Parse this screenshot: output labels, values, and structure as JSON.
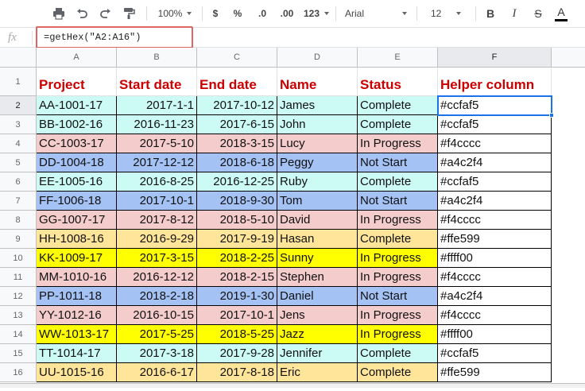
{
  "toolbar": {
    "zoom": "100%",
    "currency": "$",
    "percent": "%",
    "decrease_decimal": ".0",
    "increase_decimal": ".00",
    "number_format": "123",
    "font": "Arial",
    "font_size": "12",
    "bold": "B",
    "italic": "I",
    "strikethrough": "S",
    "text_color": "A"
  },
  "formula_bar": {
    "fx_label": "fx",
    "formula": "=getHex(\"A2:A16\")"
  },
  "columns": [
    "A",
    "B",
    "C",
    "D",
    "E",
    "F"
  ],
  "header": {
    "row_number": "1",
    "labels": [
      "Project",
      "Start date",
      "End date",
      "Name",
      "Status",
      "Helper column"
    ]
  },
  "rows": [
    {
      "n": "2",
      "project": "AA-1001-17",
      "start": "2017-1-1",
      "end": "2017-10-12",
      "name": "James",
      "status": "Complete",
      "helper": "#ccfaf5",
      "color": "#ccfaf5"
    },
    {
      "n": "3",
      "project": "BB-1002-16",
      "start": "2016-11-23",
      "end": "2017-6-15",
      "name": "John",
      "status": "Complete",
      "helper": "#ccfaf5",
      "color": "#ccfaf5"
    },
    {
      "n": "4",
      "project": "CC-1003-17",
      "start": "2017-5-10",
      "end": "2018-3-15",
      "name": "Lucy",
      "status": "In Progress",
      "helper": "#f4cccc",
      "color": "#f4cccc"
    },
    {
      "n": "5",
      "project": "DD-1004-18",
      "start": "2017-12-12",
      "end": "2018-6-18",
      "name": "Peggy",
      "status": "Not Start",
      "helper": "#a4c2f4",
      "color": "#a4c2f4"
    },
    {
      "n": "6",
      "project": "EE-1005-16",
      "start": "2016-8-25",
      "end": "2016-12-25",
      "name": "Ruby",
      "status": "Complete",
      "helper": "#ccfaf5",
      "color": "#ccfaf5"
    },
    {
      "n": "7",
      "project": "FF-1006-18",
      "start": "2017-10-1",
      "end": "2018-9-30",
      "name": "Tom",
      "status": "Not Start",
      "helper": "#a4c2f4",
      "color": "#a4c2f4"
    },
    {
      "n": "8",
      "project": "GG-1007-17",
      "start": "2017-8-12",
      "end": "2018-5-10",
      "name": "David",
      "status": "In Progress",
      "helper": "#f4cccc",
      "color": "#f4cccc"
    },
    {
      "n": "9",
      "project": "HH-1008-16",
      "start": "2016-9-29",
      "end": "2017-9-19",
      "name": "Hasan",
      "status": "Complete",
      "helper": "#ffe599",
      "color": "#ffe599"
    },
    {
      "n": "10",
      "project": "KK-1009-17",
      "start": "2017-3-15",
      "end": "2018-2-25",
      "name": "Sunny",
      "status": "In Progress",
      "helper": "#ffff00",
      "color": "#ffff00"
    },
    {
      "n": "11",
      "project": "MM-1010-16",
      "start": "2016-12-12",
      "end": "2018-2-15",
      "name": "Stephen",
      "status": "In Progress",
      "helper": "#f4cccc",
      "color": "#f4cccc"
    },
    {
      "n": "12",
      "project": "PP-1011-18",
      "start": "2018-2-18",
      "end": "2019-1-30",
      "name": "Daniel",
      "status": "Not Start",
      "helper": "#a4c2f4",
      "color": "#a4c2f4"
    },
    {
      "n": "13",
      "project": "YY-1012-16",
      "start": "2016-10-15",
      "end": "2017-10-1",
      "name": "Jens",
      "status": "In Progress",
      "helper": "#f4cccc",
      "color": "#f4cccc"
    },
    {
      "n": "14",
      "project": "WW-1013-17",
      "start": "2017-5-25",
      "end": "2018-5-25",
      "name": "Jazz",
      "status": "In Progress",
      "helper": "#ffff00",
      "color": "#ffff00"
    },
    {
      "n": "15",
      "project": "TT-1014-17",
      "start": "2017-3-18",
      "end": "2017-9-28",
      "name": "Jennifer",
      "status": "Complete",
      "helper": "#ccfaf5",
      "color": "#ccfaf5"
    },
    {
      "n": "16",
      "project": "UU-1015-16",
      "start": "2016-6-17",
      "end": "2017-8-18",
      "name": "Eric",
      "status": "Complete",
      "helper": "#ffe599",
      "color": "#ffe599"
    }
  ],
  "selection": {
    "cell": "F2",
    "color": "#1a73e8"
  }
}
